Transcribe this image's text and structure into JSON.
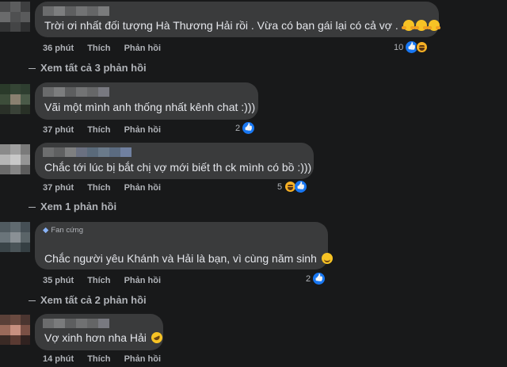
{
  "colors": {
    "background": "#18191a",
    "bubble": "#3a3b3c",
    "text": "#e4e6eb",
    "muted": "#b0b3b8",
    "like_blue": "#1877f2",
    "haha_yellow": "#f7b125"
  },
  "comments": [
    {
      "text": "Trời ơi nhất đối tượng Hà Thương Hải rồi . Vừa có bạn gái lại có cả vợ .",
      "emojis": [
        "hugging-face",
        "hugging-face",
        "hugging-face"
      ],
      "time": "36 phút",
      "like": "Thích",
      "reply": "Phản hồi",
      "reaction_count": "10",
      "reaction_icons": [
        "like-icon",
        "haha-icon"
      ],
      "more_replies": "Xem tất cả 3 phản hồi"
    },
    {
      "text": "Vãi một mình anh thống nhất kênh chat :)))",
      "time": "37 phút",
      "like": "Thích",
      "reply": "Phản hồi",
      "reaction_count": "2",
      "reaction_icons": [
        "like-icon"
      ]
    },
    {
      "text": "Chắc tới lúc bị bắt chị vợ mới biết th ck mình có bồ :)))",
      "time": "37 phút",
      "like": "Thích",
      "reply": "Phản hồi",
      "reaction_count": "5",
      "reaction_icons": [
        "haha-icon",
        "like-icon"
      ],
      "more_replies": "Xem 1 phản hồi"
    },
    {
      "badge": "Fan cứng",
      "text": "Chắc người yêu Khánh và Hải là bạn, vì cùng năm sinh",
      "emojis": [
        "slightly-smiling-face"
      ],
      "time": "35 phút",
      "like": "Thích",
      "reply": "Phản hồi",
      "reaction_count": "2",
      "reaction_icons": [
        "like-icon"
      ],
      "more_replies": "Xem tất cả 2 phản hồi"
    },
    {
      "text": "Vợ xinh hơn nha Hải",
      "emojis": [
        "rolling-on-floor-laughing"
      ],
      "time": "14 phút",
      "like": "Thích",
      "reply": "Phản hồi"
    }
  ]
}
